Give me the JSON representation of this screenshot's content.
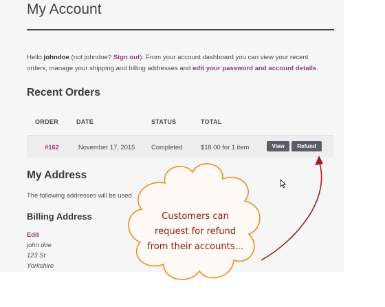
{
  "page": {
    "title": "My Account"
  },
  "intro": {
    "hello": "Hello",
    "username": "johndoe",
    "not_prefix": "(not johndoe?",
    "sign_out": "Sign out",
    "after_sign_out": "). From your account dashboard you can view your recent orders, manage your shipping and billing addresses and",
    "edit_link": "edit your password and account details",
    "end": "."
  },
  "recent_orders": {
    "heading": "Recent Orders",
    "columns": [
      "ORDER",
      "DATE",
      "STATUS",
      "TOTAL"
    ],
    "rows": [
      {
        "order": "#162",
        "date": "November 17, 2015",
        "status": "Completed",
        "total": "$18.00 for 1 item",
        "view_label": "View",
        "refund_label": "Refund"
      }
    ]
  },
  "my_address": {
    "heading": "My Address",
    "description": "The following addresses will be used"
  },
  "billing": {
    "heading": "Billing Address",
    "edit_label": "Edit",
    "lines": [
      "john doe",
      "123 St",
      "Yorkshire"
    ]
  },
  "callout": {
    "lines": [
      "Customers can",
      "request for refund",
      "from their accounts..."
    ]
  },
  "colors": {
    "link": "#8a3f73",
    "button": "#5d5d66",
    "callout_text": "#8b1414",
    "callout_border": "#f08a1c",
    "arrow": "#a11c1c"
  },
  "icons": {
    "cursor": "mouse-pointer-icon"
  }
}
